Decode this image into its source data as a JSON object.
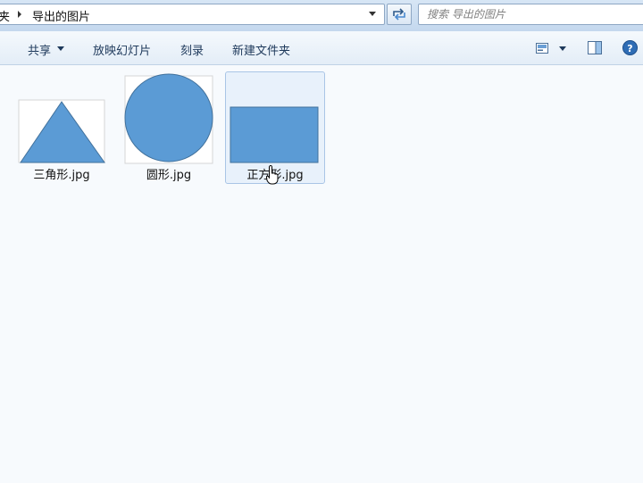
{
  "address_bar": {
    "previous_segment": "夹",
    "current_folder": "导出的图片"
  },
  "search": {
    "placeholder": "搜索 导出的图片"
  },
  "toolbar": {
    "share_label": "共享",
    "slideshow_label": "放映幻灯片",
    "burn_label": "刻录",
    "new_folder_label": "新建文件夹"
  },
  "files": [
    {
      "name": "三角形.jpg",
      "shape": "triangle",
      "selected": false
    },
    {
      "name": "圆形.jpg",
      "shape": "circle",
      "selected": false
    },
    {
      "name": "正方形.jpg",
      "shape": "rectangle",
      "selected": true
    }
  ],
  "colors": {
    "shape_fill": "#5b9bd5",
    "shape_stroke": "#41719c",
    "selection_bg": "#e8f1fb",
    "selection_border": "#a9c5e6"
  },
  "icons": {
    "refresh": "refresh-icon",
    "view": "change-view-icon",
    "preview": "preview-pane-icon",
    "help": "help-icon"
  }
}
